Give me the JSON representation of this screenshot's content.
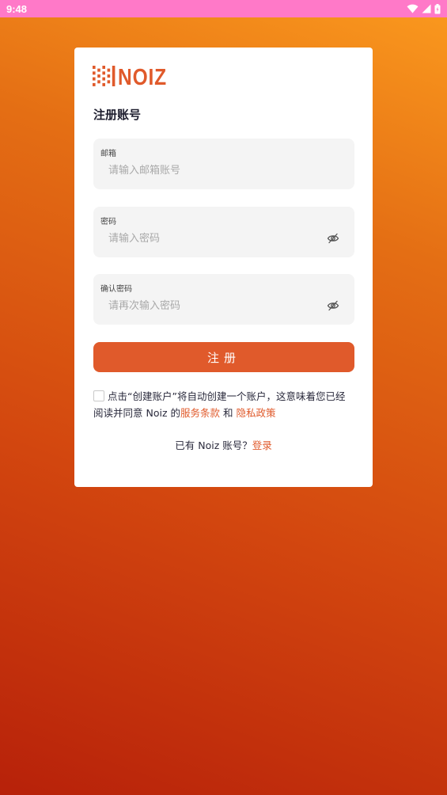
{
  "status_bar": {
    "time": "9:48",
    "icons": [
      "wifi-icon",
      "signal-icon",
      "battery-icon"
    ]
  },
  "colors": {
    "accent": "#e05a2b",
    "status_bar": "#ff79c8",
    "field_bg": "#f4f4f4"
  },
  "logo": {
    "text": "NOIZ"
  },
  "form": {
    "title": "注册账号",
    "email": {
      "label": "邮箱",
      "placeholder": "请输入邮箱账号",
      "value": ""
    },
    "password": {
      "label": "密码",
      "placeholder": "请输入密码",
      "value": "",
      "icon": "eye-slash-icon"
    },
    "confirm_password": {
      "label": "确认密码",
      "placeholder": "请再次输入密码",
      "value": "",
      "icon": "eye-slash-icon"
    },
    "submit_label": "注册"
  },
  "agreement": {
    "checked": false,
    "text_before": "点击“创建账户”将自动创建一个账户，这意味着您已经阅读并同意 Noiz 的",
    "terms_link": "服务条款",
    "and_text": " 和 ",
    "privacy_link": "隐私政策"
  },
  "login": {
    "prompt": "已有 Noiz 账号？",
    "link": "登录"
  }
}
